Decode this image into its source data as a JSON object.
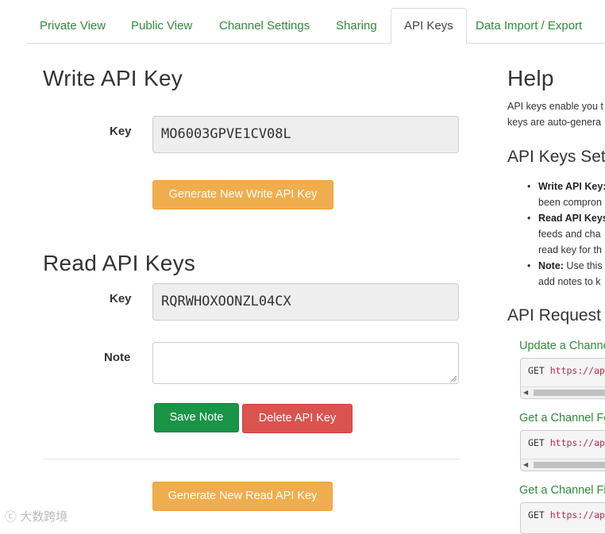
{
  "tabs": [
    {
      "label": "Private View",
      "active": false
    },
    {
      "label": "Public View",
      "active": false
    },
    {
      "label": "Channel Settings",
      "active": false
    },
    {
      "label": "Sharing",
      "active": false
    },
    {
      "label": "API Keys",
      "active": true
    },
    {
      "label": "Data Import / Export",
      "active": false
    }
  ],
  "write": {
    "title": "Write API Key",
    "key_label": "Key",
    "key_value": "MO6003GPVE1CV08L",
    "generate_label": "Generate New Write API Key"
  },
  "read": {
    "title": "Read API Keys",
    "key_label": "Key",
    "key_value": "RQRWHOXOONZL04CX",
    "note_label": "Note",
    "note_value": "",
    "save_label": "Save Note",
    "delete_label": "Delete API Key",
    "generate_label": "Generate New Read API Key"
  },
  "help": {
    "title": "Help",
    "intro_line1": "API keys enable you t",
    "intro_line2": "keys are auto-genera",
    "settings_title": "API Keys Set",
    "bullets": [
      {
        "bold": "Write API Key:",
        "lines": [
          "been compron"
        ]
      },
      {
        "bold": "Read API Keys",
        "lines": [
          "feeds and cha",
          "read key for th"
        ]
      },
      {
        "bold": "Note:",
        "text": " Use this",
        "lines": [
          "add notes to k"
        ]
      }
    ],
    "requests_title": "API Request",
    "requests": [
      {
        "title": "Update a Channe",
        "method": "GET",
        "url": "https://ap"
      },
      {
        "title": "Get a Channel Fe",
        "method": "GET",
        "url": "https://ap"
      },
      {
        "title": "Get a Channel Fi",
        "method": "GET",
        "url": "https://ap"
      }
    ]
  },
  "watermark": "大数跨境",
  "colors": {
    "accent": "#2e8b3c",
    "warning": "#f0ad4e",
    "success": "#1a9447",
    "danger": "#d9534f"
  }
}
